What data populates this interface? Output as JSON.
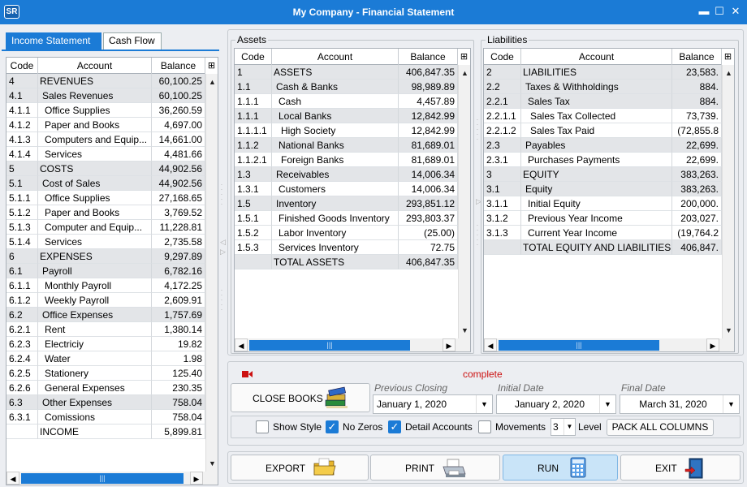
{
  "window": {
    "title": "My Company - Financial Statement",
    "logo": "SR",
    "minimize": "▬",
    "maximize": "☐",
    "close": "✕"
  },
  "tabs": {
    "income": "Income Statement",
    "cashflow": "Cash Flow"
  },
  "income": {
    "headers": [
      "Code",
      "Account",
      "Balance"
    ],
    "rows": [
      {
        "code": "4",
        "account": "REVENUES",
        "balance": "60,100.25",
        "g": 1,
        "ind": 0
      },
      {
        "code": "4.1",
        "account": "Sales Revenues",
        "balance": "60,100.25",
        "g": 1,
        "ind": 1
      },
      {
        "code": "4.1.1",
        "account": "Office Supplies",
        "balance": "36,260.59",
        "g": 0,
        "ind": 2
      },
      {
        "code": "4.1.2",
        "account": "Paper and Books",
        "balance": "4,697.00",
        "g": 0,
        "ind": 2
      },
      {
        "code": "4.1.3",
        "account": "Computers and Equip...",
        "balance": "14,661.00",
        "g": 0,
        "ind": 2
      },
      {
        "code": "4.1.4",
        "account": "Services",
        "balance": "4,481.66",
        "g": 0,
        "ind": 2
      },
      {
        "code": "5",
        "account": "COSTS",
        "balance": "44,902.56",
        "g": 1,
        "ind": 0
      },
      {
        "code": "5.1",
        "account": "Cost of Sales",
        "balance": "44,902.56",
        "g": 1,
        "ind": 1
      },
      {
        "code": "5.1.1",
        "account": "Office Supplies",
        "balance": "27,168.65",
        "g": 0,
        "ind": 2
      },
      {
        "code": "5.1.2",
        "account": "Paper and Books",
        "balance": "3,769.52",
        "g": 0,
        "ind": 2
      },
      {
        "code": "5.1.3",
        "account": "Computer and Equip...",
        "balance": "11,228.81",
        "g": 0,
        "ind": 2
      },
      {
        "code": "5.1.4",
        "account": "Services",
        "balance": "2,735.58",
        "g": 0,
        "ind": 2
      },
      {
        "code": "6",
        "account": "EXPENSES",
        "balance": "9,297.89",
        "g": 1,
        "ind": 0
      },
      {
        "code": "6.1",
        "account": "Payroll",
        "balance": "6,782.16",
        "g": 1,
        "ind": 1
      },
      {
        "code": "6.1.1",
        "account": "Monthly Payroll",
        "balance": "4,172.25",
        "g": 0,
        "ind": 2
      },
      {
        "code": "6.1.2",
        "account": "Weekly Payroll",
        "balance": "2,609.91",
        "g": 0,
        "ind": 2
      },
      {
        "code": "6.2",
        "account": "Office Expenses",
        "balance": "1,757.69",
        "g": 1,
        "ind": 1
      },
      {
        "code": "6.2.1",
        "account": "Rent",
        "balance": "1,380.14",
        "g": 0,
        "ind": 2
      },
      {
        "code": "6.2.3",
        "account": "Electriciy",
        "balance": "19.82",
        "g": 0,
        "ind": 2
      },
      {
        "code": "6.2.4",
        "account": "Water",
        "balance": "1.98",
        "g": 0,
        "ind": 2
      },
      {
        "code": "6.2.5",
        "account": "Stationery",
        "balance": "125.40",
        "g": 0,
        "ind": 2
      },
      {
        "code": "6.2.6",
        "account": "General Expenses",
        "balance": "230.35",
        "g": 0,
        "ind": 2
      },
      {
        "code": "6.3",
        "account": "Other Expenses",
        "balance": "758.04",
        "g": 1,
        "ind": 1
      },
      {
        "code": "6.3.1",
        "account": "Comissions",
        "balance": "758.04",
        "g": 0,
        "ind": 2
      },
      {
        "code": "",
        "account": "INCOME",
        "balance": "5,899.81",
        "g": 0,
        "ind": 0
      }
    ]
  },
  "assets": {
    "legend": "Assets",
    "headers": [
      "Code",
      "Account",
      "Balance"
    ],
    "rows": [
      {
        "code": "1",
        "account": "ASSETS",
        "balance": "406,847.35",
        "g": 1,
        "ind": 0
      },
      {
        "code": "1.1",
        "account": "Cash & Banks",
        "balance": "98,989.89",
        "g": 1,
        "ind": 1
      },
      {
        "code": "1.1.1",
        "account": "Cash",
        "balance": "4,457.89",
        "g": 0,
        "ind": 2
      },
      {
        "code": "1.1.1",
        "account": "Local Banks",
        "balance": "12,842.99",
        "g": 1,
        "ind": 2
      },
      {
        "code": "1.1.1.1",
        "account": "High Society",
        "balance": "12,842.99",
        "g": 0,
        "ind": 3
      },
      {
        "code": "1.1.2",
        "account": "National Banks",
        "balance": "81,689.01",
        "g": 1,
        "ind": 2
      },
      {
        "code": "1.1.2.1",
        "account": "Foreign Banks",
        "balance": "81,689.01",
        "g": 0,
        "ind": 3
      },
      {
        "code": "1.3",
        "account": "Receivables",
        "balance": "14,006.34",
        "g": 1,
        "ind": 1
      },
      {
        "code": "1.3.1",
        "account": "Customers",
        "balance": "14,006.34",
        "g": 0,
        "ind": 2
      },
      {
        "code": "1.5",
        "account": "Inventory",
        "balance": "293,851.12",
        "g": 1,
        "ind": 1
      },
      {
        "code": "1.5.1",
        "account": "Finished Goods Inventory",
        "balance": "293,803.37",
        "g": 0,
        "ind": 2
      },
      {
        "code": "1.5.2",
        "account": "Labor Inventory",
        "balance": "(25.00)",
        "g": 0,
        "ind": 2
      },
      {
        "code": "1.5.3",
        "account": "Services Inventory",
        "balance": "72.75",
        "g": 0,
        "ind": 2
      },
      {
        "code": "",
        "account": "TOTAL ASSETS",
        "balance": "406,847.35",
        "g": 1,
        "ind": 0
      }
    ]
  },
  "liabilities": {
    "legend": "Liabilities",
    "headers": [
      "Code",
      "Account",
      "Balance"
    ],
    "rows": [
      {
        "code": "2",
        "account": "LIABILITIES",
        "balance": "23,583.",
        "g": 1,
        "ind": 0
      },
      {
        "code": "2.2",
        "account": "Taxes & Withholdings",
        "balance": "884.",
        "g": 1,
        "ind": 1
      },
      {
        "code": "2.2.1",
        "account": "Sales Tax",
        "balance": "884.",
        "g": 1,
        "ind": 2
      },
      {
        "code": "2.2.1.1",
        "account": "Sales Tax Collected",
        "balance": "73,739.",
        "g": 0,
        "ind": 3
      },
      {
        "code": "2.2.1.2",
        "account": "Sales Tax Paid",
        "balance": "(72,855.8",
        "g": 0,
        "ind": 3
      },
      {
        "code": "2.3",
        "account": "Payables",
        "balance": "22,699.",
        "g": 1,
        "ind": 1
      },
      {
        "code": "2.3.1",
        "account": "Purchases Payments",
        "balance": "22,699.",
        "g": 0,
        "ind": 2
      },
      {
        "code": "3",
        "account": "EQUITY",
        "balance": "383,263.",
        "g": 1,
        "ind": 0
      },
      {
        "code": "3.1",
        "account": "Equity",
        "balance": "383,263.",
        "g": 1,
        "ind": 1
      },
      {
        "code": "3.1.1",
        "account": "Initial Equity",
        "balance": "200,000.",
        "g": 0,
        "ind": 2
      },
      {
        "code": "3.1.2",
        "account": "Previous Year Income",
        "balance": "203,027.",
        "g": 0,
        "ind": 2
      },
      {
        "code": "3.1.3",
        "account": "Current Year Income",
        "balance": "(19,764.2",
        "g": 0,
        "ind": 2
      },
      {
        "code": "",
        "account": "TOTAL EQUITY AND LIABILITIES",
        "balance": "406,847.",
        "g": 1,
        "ind": 0
      }
    ]
  },
  "status": {
    "text": "complete",
    "color": "#cc1111"
  },
  "controls": {
    "close_books": "CLOSE BOOKS",
    "previous_closing_label": "Previous Closing",
    "previous_closing": "January 1, 2020",
    "initial_date_label": "Initial Date",
    "initial_date": "January 2, 2020",
    "final_date_label": "Final Date",
    "final_date": "March 31, 2020"
  },
  "options": {
    "show_style": "Show Style",
    "no_zeros": "No Zeros",
    "detail_accounts": "Detail Accounts",
    "movements": "Movements",
    "level_value": "3",
    "level_label": "Level",
    "pack_columns": "PACK ALL COLUMNS"
  },
  "buttons": {
    "export": "EXPORT",
    "print": "PRINT",
    "run": "RUN",
    "exit": "EXIT"
  },
  "colors": {
    "accent": "#1b7bd6"
  }
}
